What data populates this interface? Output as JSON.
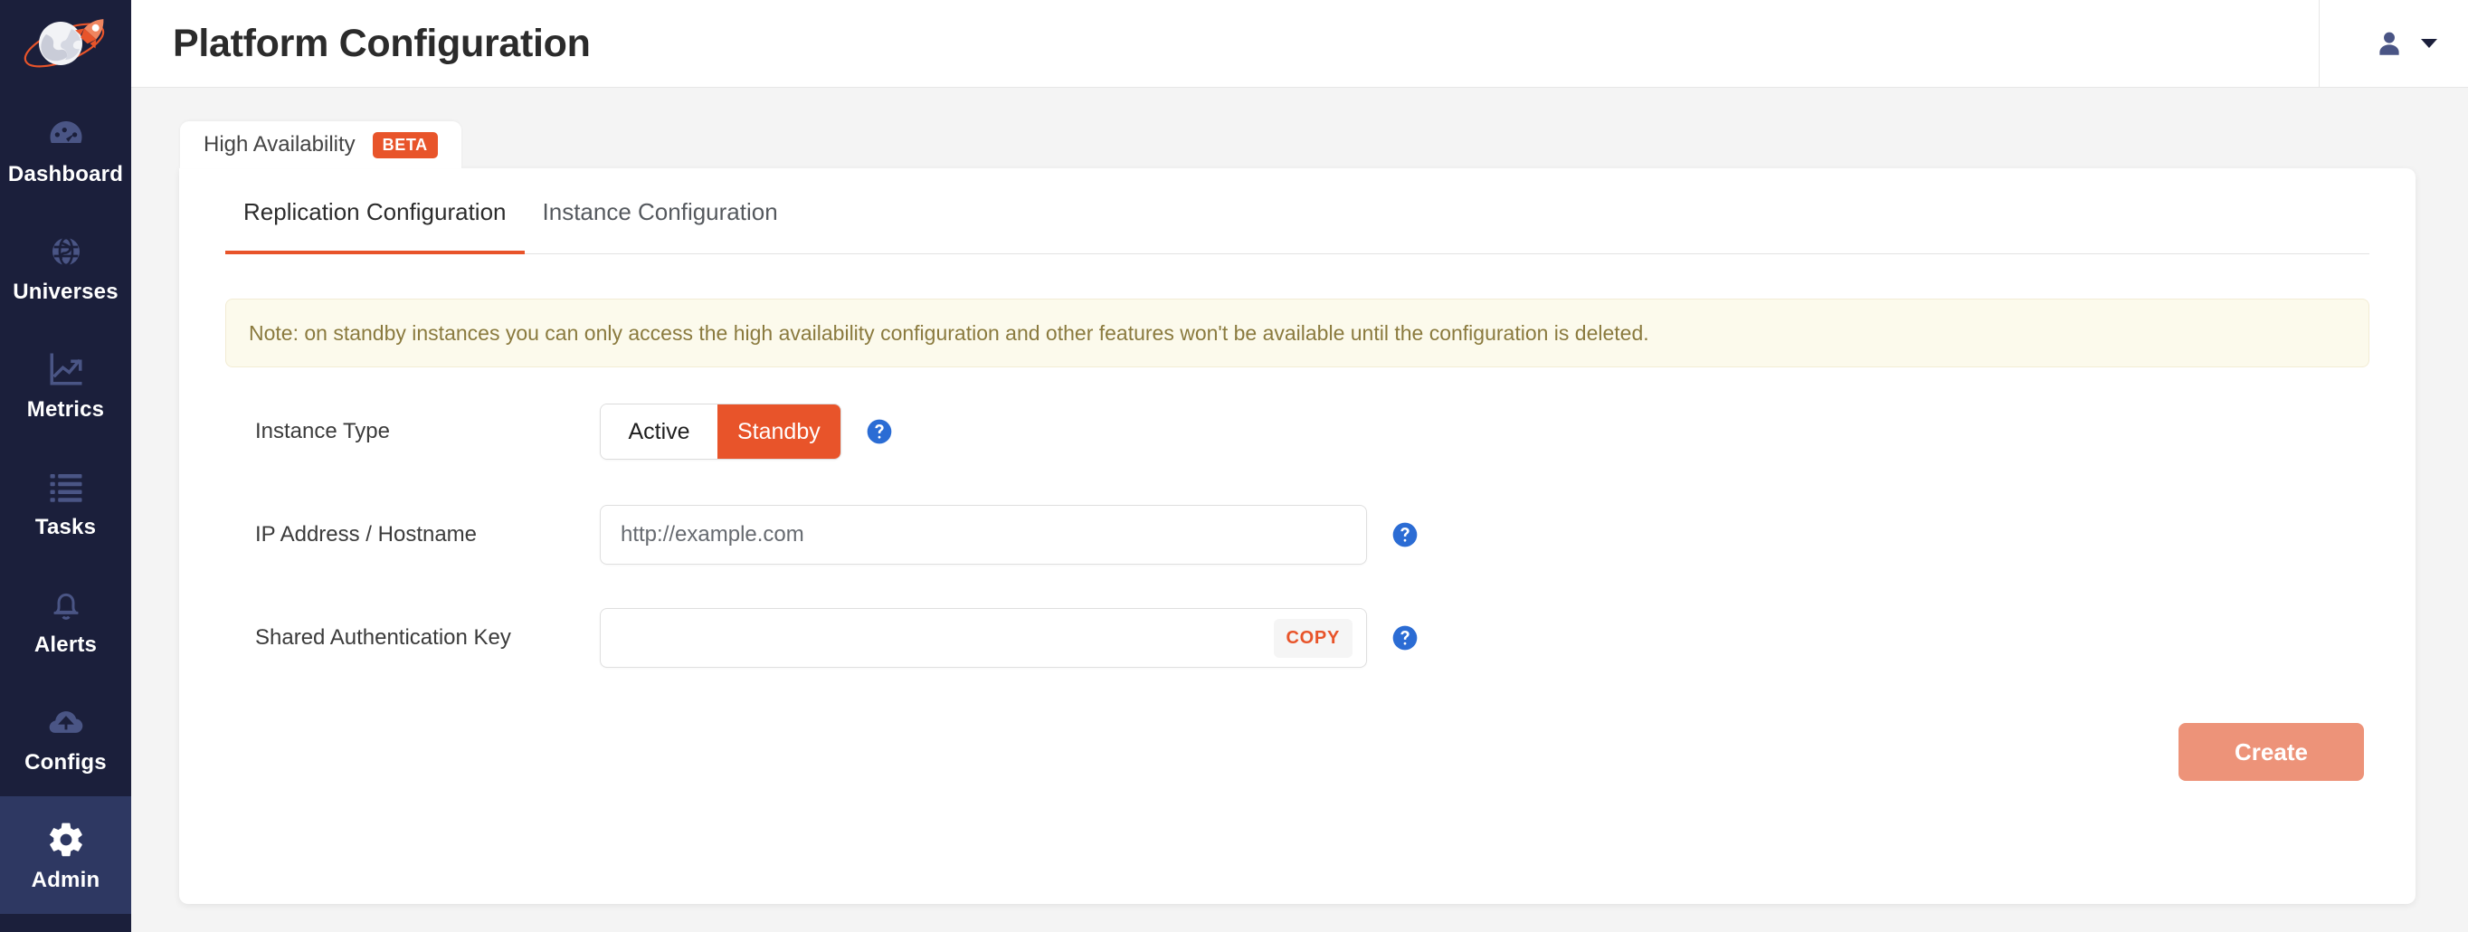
{
  "colors": {
    "accent": "#e8542a",
    "sidebar_bg": "#1b1f3b",
    "sidebar_active_bg": "#2e3862",
    "help_blue": "#2b6cd4",
    "note_bg": "#fcfaec",
    "note_text": "#8a7a3e",
    "create_btn_bg": "#ed9379"
  },
  "sidebar": {
    "logo_name": "yugabyte-rocket-planet-logo",
    "items": [
      {
        "label": "Dashboard",
        "icon": "dashboard-gauge-icon",
        "active": false
      },
      {
        "label": "Universes",
        "icon": "globe-icon",
        "active": false
      },
      {
        "label": "Metrics",
        "icon": "chart-line-icon",
        "active": false
      },
      {
        "label": "Tasks",
        "icon": "list-icon",
        "active": false
      },
      {
        "label": "Alerts",
        "icon": "bell-icon",
        "active": false
      },
      {
        "label": "Configs",
        "icon": "cloud-upload-icon",
        "active": false
      },
      {
        "label": "Admin",
        "icon": "gear-icon",
        "active": true
      }
    ]
  },
  "header": {
    "title": "Platform Configuration",
    "avatar_icon": "user-avatar-icon",
    "caret_icon": "chevron-down-icon"
  },
  "outer_tab": {
    "label": "High Availability",
    "badge": "BETA"
  },
  "sub_tabs": [
    {
      "label": "Replication Configuration",
      "active": true
    },
    {
      "label": "Instance Configuration",
      "active": false
    }
  ],
  "note": {
    "text": "Note: on standby instances you can only access the high availability configuration and other features won't be available until the configuration is deleted."
  },
  "form": {
    "instance_type": {
      "label": "Instance Type",
      "options": [
        "Active",
        "Standby"
      ],
      "selected": "Standby",
      "help_icon": "help-circle-icon"
    },
    "ip_address": {
      "label": "IP Address / Hostname",
      "value": "",
      "placeholder": "http://example.com",
      "help_icon": "help-circle-icon"
    },
    "auth_key": {
      "label": "Shared Authentication Key",
      "value": "",
      "placeholder": "",
      "copy_label": "COPY",
      "help_icon": "help-circle-icon"
    }
  },
  "footer": {
    "create_label": "Create"
  }
}
